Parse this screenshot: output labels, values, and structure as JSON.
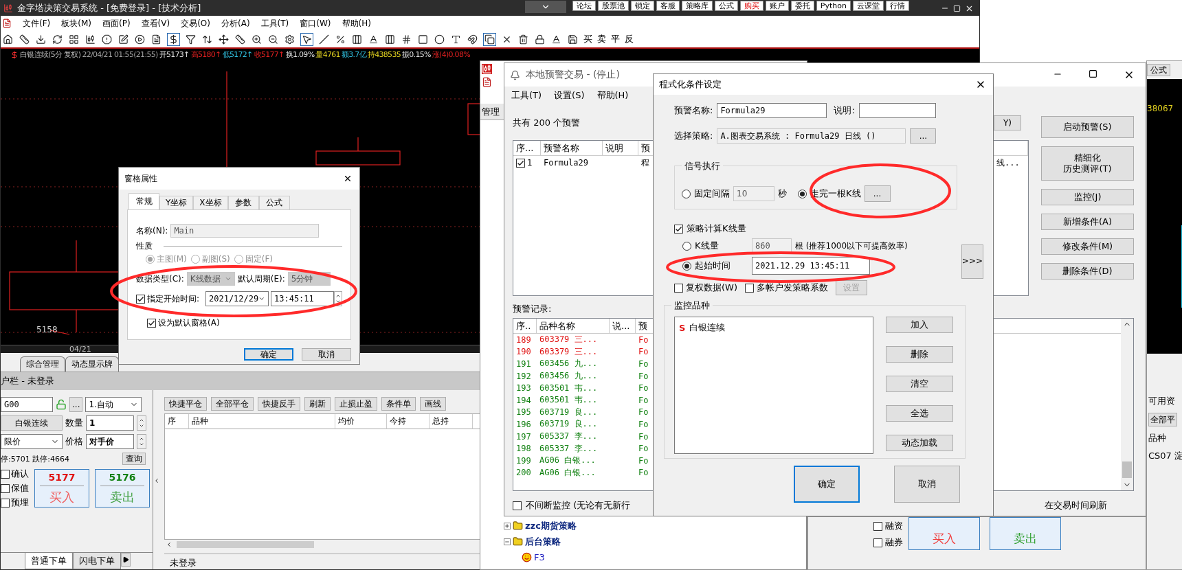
{
  "top_buttons": [
    {
      "label": "论坛",
      "emphasis": false
    },
    {
      "label": "股票池",
      "emphasis": false
    },
    {
      "label": "锁定",
      "emphasis": false
    },
    {
      "label": "客服",
      "emphasis": false
    },
    {
      "label": "策略库",
      "emphasis": false
    },
    {
      "label": "公式",
      "emphasis": false
    },
    {
      "label": "购买",
      "emphasis": true
    },
    {
      "label": "账户",
      "emphasis": false
    },
    {
      "label": "委托",
      "emphasis": false
    },
    {
      "label": "Python",
      "emphasis": false
    },
    {
      "label": "云课堂",
      "emphasis": false
    },
    {
      "label": "行情",
      "emphasis": false
    }
  ],
  "main_window": {
    "title": "金字塔决策交易系统 - [免费登录] - [技术分析]",
    "menus": [
      "文件(F)",
      "板块(M)",
      "画面(P)",
      "查看(V)",
      "交易(O)",
      "分析(A)",
      "工具(T)",
      "窗口(W)",
      "帮助(H)"
    ],
    "toolbar_text_buttons": [
      "买",
      "卖",
      "平",
      "反"
    ],
    "quote": [
      {
        "text": "白银连续(5分 复权)",
        "color": "#b8b8b8"
      },
      {
        "text": "22/04/21 01:55(21:55)",
        "color": "#a0a0a0"
      },
      {
        "text": "开5173↑",
        "color": "#e0e0e0"
      },
      {
        "text": "高5180↑",
        "color": "#e02020"
      },
      {
        "text": "低5172↑",
        "color": "#30c0e0"
      },
      {
        "text": "收5177↑",
        "color": "#e02020"
      },
      {
        "text": "换1.09%",
        "color": "#e0e0e0"
      },
      {
        "text": "量4761",
        "color": "#e0d020"
      },
      {
        "text": "额3.7亿",
        "color": "#30c0e0"
      },
      {
        "text": "持438535",
        "color": "#e0d020"
      },
      {
        "text": "振0.15%",
        "color": "#e0e0e0"
      },
      {
        "text": "涨(4)0.08%",
        "color": "#e02020"
      }
    ],
    "chart": {
      "price_label": "5158",
      "date_label": "04/21"
    },
    "bottom_tabs": [
      {
        "label": "综合管理",
        "selected": false
      },
      {
        "label": "动态显示牌",
        "selected": false
      }
    ],
    "account_bar": "户栏 - 未登录",
    "order": {
      "symbol": "G00",
      "more": "...",
      "mode": "1.自动",
      "contract": "白银连续",
      "qty_label": "数量",
      "qty": "1",
      "price_type": "限价",
      "price_label": "价格",
      "price": "对手价",
      "limits": "停:5701 跌停:4664",
      "query": "查询",
      "checks": [
        {
          "label": "确认",
          "checked": false
        },
        {
          "label": "保值",
          "checked": false
        },
        {
          "label": "预埋",
          "checked": false
        }
      ],
      "buy": {
        "price": "5177",
        "label": "买入"
      },
      "sell": {
        "price": "5176",
        "label": "卖出"
      },
      "tabs": [
        {
          "label": "普通下单",
          "selected": true
        },
        {
          "label": "闪电下单",
          "selected": false
        }
      ]
    },
    "positions": {
      "buttons": [
        "快捷平仓",
        "全部平仓",
        "快捷反手",
        "刷新",
        "止损止盈",
        "条件单",
        "画线"
      ],
      "columns": [
        "序",
        "品种",
        "均价",
        "今持",
        "总持"
      ],
      "status": "未登录"
    }
  },
  "strategy_window": {
    "tab": "管理",
    "tree": [
      {
        "label": "zzc期货策略",
        "expanded": false
      },
      {
        "label": "后台策略",
        "expanded": true,
        "children": [
          {
            "label": "F3"
          }
        ]
      }
    ]
  },
  "alert_window": {
    "title": "本地预警交易 - (停止)",
    "menus": [
      "工具(T)",
      "设置(S)",
      "帮助(H)"
    ],
    "summary": "共有 200 个预警",
    "side_button": "Y)",
    "alert_columns": [
      "序...",
      "预警名称",
      "说明",
      "预"
    ],
    "alerts": [
      {
        "checked": true,
        "cells": [
          "1",
          "Formula29",
          "",
          "程",
          "线..."
        ]
      }
    ],
    "actions": [
      {
        "lines": [
          "启动预警(S)"
        ]
      },
      {
        "lines": [
          "精细化",
          "历史测评(T)"
        ]
      },
      {
        "lines": [
          "监控(J)"
        ]
      },
      {
        "lines": [
          "新增条件(A)"
        ]
      },
      {
        "lines": [
          "修改条件(M)"
        ]
      },
      {
        "lines": [
          "删除条件(D)"
        ]
      }
    ],
    "records_label": "预警记录:",
    "record_columns": [
      "序..",
      "品种名称",
      "说...",
      "预"
    ],
    "records": [
      {
        "cells": [
          "189",
          "603379 三...",
          "",
          "Fo"
        ],
        "color": "#e01010"
      },
      {
        "cells": [
          "190",
          "603379 三...",
          "",
          "Fo"
        ],
        "color": "#e01010"
      },
      {
        "cells": [
          "191",
          "603456 九...",
          "",
          "Fo"
        ],
        "color": "#108010"
      },
      {
        "cells": [
          "192",
          "603456 九...",
          "",
          "Fo"
        ],
        "color": "#108010"
      },
      {
        "cells": [
          "193",
          "603501 韦...",
          "",
          "Fo"
        ],
        "color": "#108010"
      },
      {
        "cells": [
          "194",
          "603501 韦...",
          "",
          "Fo"
        ],
        "color": "#108010"
      },
      {
        "cells": [
          "195",
          "603719 良...",
          "",
          "Fo"
        ],
        "color": "#108010"
      },
      {
        "cells": [
          "196",
          "603719 良...",
          "",
          "Fo"
        ],
        "color": "#108010"
      },
      {
        "cells": [
          "197",
          "605337 李...",
          "",
          "Fo"
        ],
        "color": "#108010"
      },
      {
        "cells": [
          "198",
          "605337 李...",
          "",
          "Fo"
        ],
        "color": "#108010"
      },
      {
        "cells": [
          "199",
          "AG06 白银...",
          "",
          "Fo"
        ],
        "color": "#108010"
      },
      {
        "cells": [
          "200",
          "AG06 白银...",
          "",
          "Fo"
        ],
        "color": "#108010"
      }
    ],
    "continuous": {
      "label": "不间断监控 (无论有无新行",
      "checked": false
    },
    "refresh_note": "在交易时间刷新"
  },
  "condition_dialog": {
    "title": "程式化条件设定",
    "name_label": "预警名称:",
    "name": "Formula29",
    "note_label": "说明:",
    "strategy_label": "选择策略:",
    "strategy": "A.图表交易系统 : Formula29 日线 ()",
    "browse": "...",
    "signal_group": {
      "title": "信号执行",
      "options": [
        {
          "label": "固定间隔",
          "selected": false,
          "value": "10",
          "unit": "秒"
        },
        {
          "label": "走完一根K线",
          "selected": true,
          "button": "..."
        }
      ]
    },
    "bar_count": {
      "label": "策略计算K线量",
      "checked": true,
      "options": [
        {
          "label": "K线量",
          "selected": false,
          "value": "860",
          "note": "根 (推荐1000以下可提高效率)"
        },
        {
          "label": "起始时间",
          "selected": true,
          "value": "2021.12.29 13:45:11"
        }
      ]
    },
    "expand": ">>>",
    "extra_checks": [
      {
        "label": "复权数据(W)",
        "checked": false
      },
      {
        "label": "多帐户发策略系数",
        "checked": false
      }
    ],
    "settings_button": {
      "label": "设置",
      "disabled": true
    },
    "symbols_group": {
      "title": "监控品种",
      "items": [
        {
          "mark": "S",
          "name": "白银连续"
        }
      ],
      "buttons": [
        "加入",
        "删除",
        "清空",
        "全选",
        "动态加载"
      ]
    },
    "ok": "确定",
    "cancel": "取消"
  },
  "pane_dialog": {
    "title": "窗格属性",
    "tabs": [
      {
        "label": "常规",
        "selected": true
      },
      {
        "label": "Y坐标",
        "selected": false
      },
      {
        "label": "X坐标",
        "selected": false
      },
      {
        "label": "参数",
        "selected": false
      },
      {
        "label": "公式",
        "selected": false
      }
    ],
    "name_label": "名称(N):",
    "name": "Main",
    "section": "性质",
    "types": [
      {
        "label": "主图(M)",
        "selected": true
      },
      {
        "label": "副图(S)",
        "selected": false
      },
      {
        "label": "固定(F)",
        "selected": false
      }
    ],
    "data_type_label": "数据类型(C):",
    "data_type": "K线数据",
    "period_label": "默认周期(E):",
    "period": "5分钟",
    "start": {
      "label": "指定开始时间:",
      "checked": true,
      "date": "2021/12/29",
      "time": "13:45:11"
    },
    "default": {
      "label": "设为默认窗格(A)",
      "checked": true
    },
    "ok": "确定",
    "cancel": "取消"
  },
  "trade_panel": {
    "checks": [
      {
        "label": "融资",
        "checked": false
      },
      {
        "label": "融券",
        "checked": false
      }
    ],
    "buy": "买入",
    "sell": "卖出"
  },
  "right_strip": {
    "button": "公式",
    "value": "38067",
    "labels": [
      "可用资",
      "品种",
      "CS07 淀"
    ],
    "action": "全部平"
  }
}
